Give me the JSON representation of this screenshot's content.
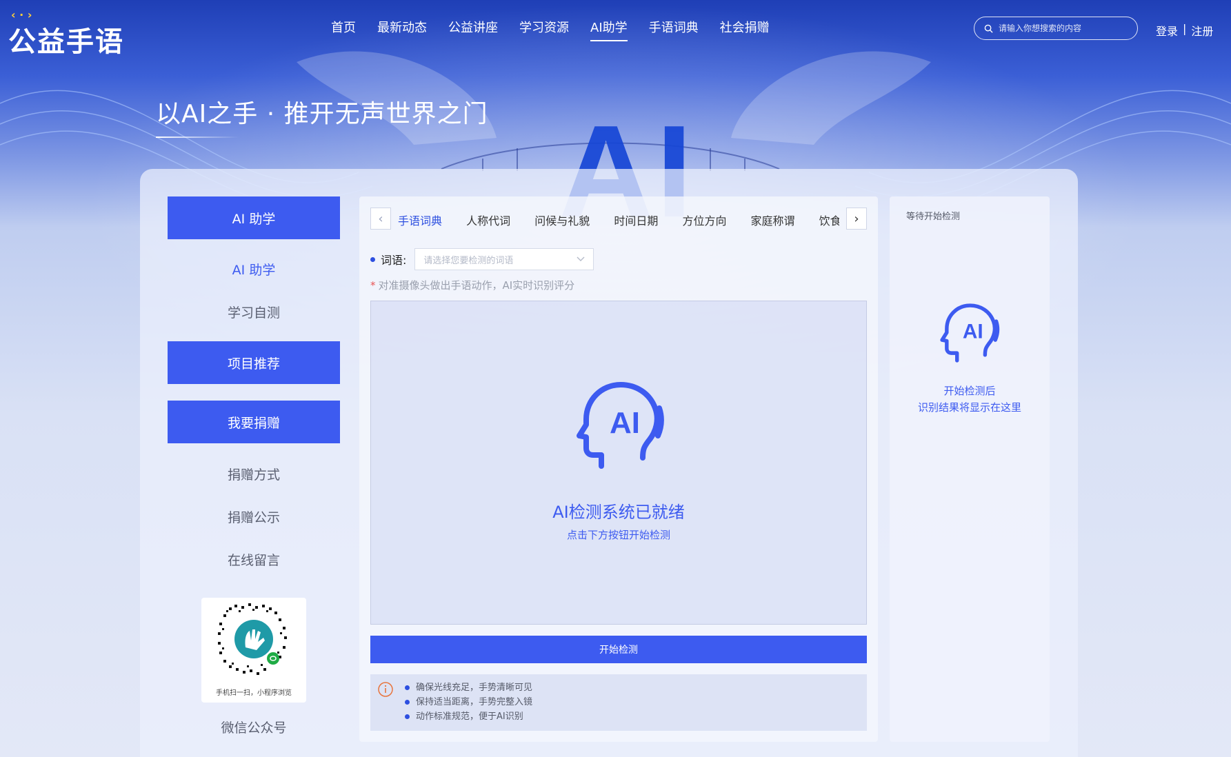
{
  "header": {
    "logo_text": "公益手语",
    "nav": [
      "首页",
      "最新动态",
      "公益讲座",
      "学习资源",
      "AI助学",
      "手语词典",
      "社会捐赠"
    ],
    "active_nav": "AI助学",
    "search_placeholder": "请输入你想搜索的内容",
    "login": "登录",
    "separator": "|",
    "register": "注册"
  },
  "hero": {
    "title": "以AI之手 · 推开无声世界之门",
    "bg_text": "AI"
  },
  "sidebar": {
    "ai_assist_button": "AI 助学",
    "ai_assist_link": "AI 助学",
    "self_test_link": "学习自测",
    "project_button": "项目推荐",
    "donate_button": "我要捐赠",
    "donate_method_link": "捐赠方式",
    "donate_public_link": "捐赠公示",
    "message_link": "在线留言",
    "qr_caption": "手机扫一扫，小程序浏览",
    "wechat_label": "微信公众号"
  },
  "detector": {
    "tabs": [
      "手语词典",
      "人称代词",
      "问候与礼貌",
      "时间日期",
      "方位方向",
      "家庭称谓",
      "饮食餐"
    ],
    "active_tab": "手语词典",
    "word_label": "词语:",
    "word_placeholder": "请选择您要检测的词语",
    "hint_star": "*",
    "hint": "对准摄像头做出手语动作，AI实时识别评分",
    "status_title": "AI检测系统已就绪",
    "status_sub": "点击下方按钮开始检测",
    "start_button": "开始检测",
    "tips": [
      "确保光线充足，手势清晰可见",
      "保持适当距离，手势完整入镜",
      "动作标准规范，便于AI识别"
    ]
  },
  "result": {
    "status": "等待开始检测",
    "message_line1": "开始检测后",
    "message_line2": "识别结果将显示在这里"
  },
  "colors": {
    "primary": "#3d5bf0",
    "header_blue": "#1f3fb6",
    "text_gray": "#5a5f70"
  }
}
